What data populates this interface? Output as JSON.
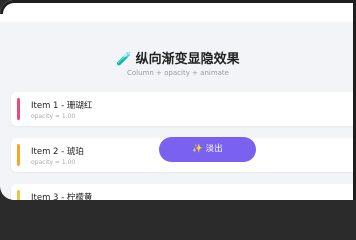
{
  "page": {
    "title": "纵向渐变显隐效果",
    "subtitle": "Column + opacity + animate"
  },
  "items": [
    {
      "label": "Item 1 - 珊瑚红",
      "sub": "opacity = 1.00",
      "color": "#e74c7a"
    },
    {
      "label": "Item 2 - 琥珀",
      "sub": "opacity = 1.00",
      "color": "#f5a623"
    },
    {
      "label": "Item 3 - 柠檬黄",
      "sub": "",
      "color": "#f3c53a"
    }
  ],
  "fab": {
    "icon": "sparkles-icon",
    "label": "✨ 淡出"
  },
  "colors": {
    "accent": "#7b61f0",
    "background": "#f3f4f7"
  }
}
